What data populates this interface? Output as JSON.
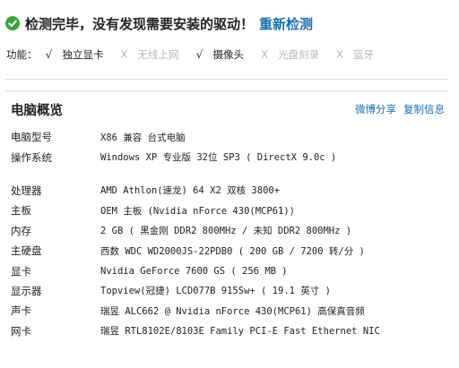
{
  "header": {
    "status_text": "检测完毕，没有发现需要安装的驱动！",
    "rescan_label": "重新检测",
    "check_color": "#3aa63a"
  },
  "features": {
    "label": "功能：",
    "items": [
      {
        "name": "独立显卡",
        "mark": "√",
        "enabled": true
      },
      {
        "name": "无线上网",
        "mark": "X",
        "enabled": false
      },
      {
        "name": "摄像头",
        "mark": "√",
        "enabled": true
      },
      {
        "name": "光盘刻录",
        "mark": "X",
        "enabled": false
      },
      {
        "name": "蓝牙",
        "mark": "X",
        "enabled": false
      }
    ]
  },
  "overview": {
    "title": "电脑概览",
    "share_label": "微博分享",
    "copy_label": "复制信息",
    "rows": [
      {
        "label": "电脑型号",
        "value": "X86 兼容 台式电脑"
      },
      {
        "label": "操作系统",
        "value": "Windows XP 专业版 32位 SP3 ( DirectX 9.0c )"
      },
      {
        "label": "处理器",
        "value": "AMD Athlon(速龙) 64 X2 双核 3800+"
      },
      {
        "label": "主板",
        "value": "OEM 主板 (Nvidia nForce 430(MCP61))"
      },
      {
        "label": "内存",
        "value": "2 GB ( 黑金刚 DDR2 800MHz / 未知 DDR2 800MHz )"
      },
      {
        "label": "主硬盘",
        "value": "西数 WDC WD2000JS-22PDB0 ( 200 GB / 7200 转/分 )"
      },
      {
        "label": "显卡",
        "value": "Nvidia GeForce 7600 GS ( 256 MB )"
      },
      {
        "label": "显示器",
        "value": "Topview(冠捷) LCD077B 915Sw+ ( 19.1 英寸 )"
      },
      {
        "label": "声卡",
        "value": "瑞昱 ALC662 @ Nvidia nForce 430(MCP61) 高保真音频"
      },
      {
        "label": "网卡",
        "value": "瑞昱 RTL8102E/8103E Family PCI-E Fast Ethernet NIC"
      }
    ]
  }
}
